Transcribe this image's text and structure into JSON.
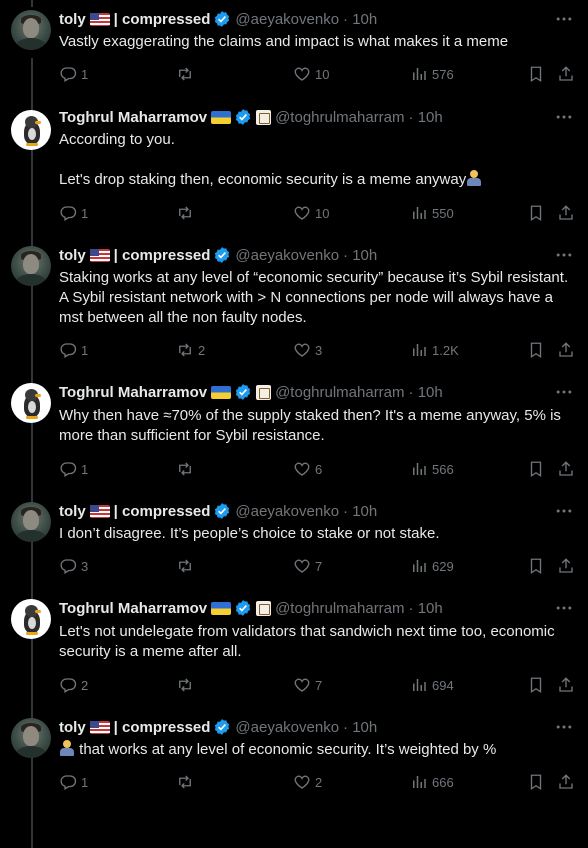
{
  "tweets": [
    {
      "author": "toly",
      "flag": "us",
      "suffix": "| compressed",
      "handle": "@aeyakovenko",
      "time": "· 10h",
      "text": "Vastly exaggerating the claims and impact is what makes it a meme",
      "replies": "1",
      "retweets": "",
      "likes": "10",
      "views": "576"
    },
    {
      "author": "Toghrul Maharramov",
      "flag": "ua",
      "suffix": "",
      "handle": "@toghrulmaharram",
      "time": "· 10h",
      "text": "According to you.\n\nLet's drop staking then, economic security is a meme anyway",
      "replies": "1",
      "retweets": "",
      "likes": "10",
      "views": "550"
    },
    {
      "author": "toly",
      "flag": "us",
      "suffix": "| compressed",
      "handle": "@aeyakovenko",
      "time": "· 10h",
      "text": "Staking works at any level of “economic security” because it’s Sybil resistant. A Sybil resistant network with > N connections per node will always have a mst between all the non faulty nodes.",
      "replies": "1",
      "retweets": "2",
      "likes": "3",
      "views": "1.2K"
    },
    {
      "author": "Toghrul Maharramov",
      "flag": "ua",
      "suffix": "",
      "handle": "@toghrulmaharram",
      "time": "· 10h",
      "text": "Why then have ≈70% of the supply staked then? It's a meme anyway, 5% is more than sufficient for Sybil resistance.",
      "replies": "1",
      "retweets": "",
      "likes": "6",
      "views": "566"
    },
    {
      "author": "toly",
      "flag": "us",
      "suffix": "| compressed",
      "handle": "@aeyakovenko",
      "time": "· 10h",
      "text": "I don’t disagree. It’s people’s choice to stake or not stake.",
      "replies": "3",
      "retweets": "",
      "likes": "7",
      "views": "629"
    },
    {
      "author": "Toghrul Maharramov",
      "flag": "ua",
      "suffix": "",
      "handle": "@toghrulmaharram",
      "time": "· 10h",
      "text": "Let's not undelegate from validators that sandwich next time too, economic security is a meme after all.",
      "replies": "2",
      "retweets": "",
      "likes": "7",
      "views": "694"
    },
    {
      "author": "toly",
      "flag": "us",
      "suffix": "| compressed",
      "handle": "@aeyakovenko",
      "time": "· 10h",
      "text": "that works at any level of economic security. It’s weighted by %",
      "replies": "1",
      "retweets": "",
      "likes": "2",
      "views": "666"
    }
  ],
  "icons": {
    "reply": "reply-icon",
    "retweet": "retweet-icon",
    "like": "heart-icon",
    "views": "views-icon",
    "bookmark": "bookmark-icon",
    "share": "share-icon",
    "more": "more-icon",
    "verified": "verified-badge-icon"
  },
  "colors": {
    "background": "#000000",
    "text": "#e7e9ea",
    "muted": "#71767b",
    "verified": "#1d9bf0",
    "thread_line": "#333639"
  }
}
